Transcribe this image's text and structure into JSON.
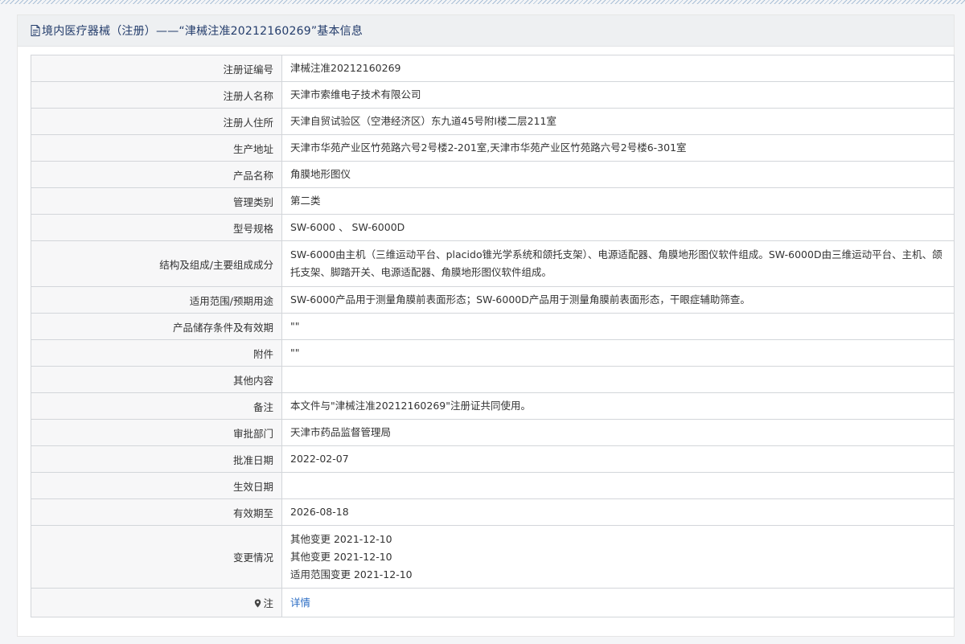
{
  "header": {
    "title": "境内医疗器械（注册）——“津械注准20212160269”基本信息",
    "icon": "document-icon"
  },
  "rows": [
    {
      "label": "注册证编号",
      "value": "津械注准20212160269"
    },
    {
      "label": "注册人名称",
      "value": "天津市索维电子技术有限公司"
    },
    {
      "label": "注册人住所",
      "value": "天津自贸试验区（空港经济区）东九道45号附I楼二层211室"
    },
    {
      "label": "生产地址",
      "value": "天津市华苑产业区竹苑路六号2号楼2-201室,天津市华苑产业区竹苑路六号2号楼6-301室"
    },
    {
      "label": "产品名称",
      "value": "角膜地形图仪"
    },
    {
      "label": "管理类别",
      "value": "第二类"
    },
    {
      "label": "型号规格",
      "value": "SW-6000 、 SW-6000D"
    },
    {
      "label": "结构及组成/主要组成成分",
      "value": "SW-6000由主机（三维运动平台、placido锥光学系统和颌托支架）、电源适配器、角膜地形图仪软件组成。SW-6000D由三维运动平台、主机、颌托支架、脚踏开关、电源适配器、角膜地形图仪软件组成。"
    },
    {
      "label": "适用范围/预期用途",
      "value": "SW-6000产品用于测量角膜前表面形态；SW-6000D产品用于测量角膜前表面形态，干眼症辅助筛查。"
    },
    {
      "label": "产品储存条件及有效期",
      "value": "\"\""
    },
    {
      "label": "附件",
      "value": "\"\""
    },
    {
      "label": "其他内容",
      "value": ""
    },
    {
      "label": "备注",
      "value": "本文件与\"津械注准20212160269\"注册证共同使用。"
    },
    {
      "label": "审批部门",
      "value": "天津市药品监督管理局"
    },
    {
      "label": "批准日期",
      "value": "2022-02-07"
    },
    {
      "label": "生效日期",
      "value": ""
    },
    {
      "label": "有效期至",
      "value": "2026-08-18"
    }
  ],
  "changes": {
    "label": "变更情况",
    "items": [
      "其他变更 2021-12-10",
      "其他变更 2021-12-10",
      "适用范围变更 2021-12-10"
    ]
  },
  "note": {
    "label": "注",
    "icon": "pin-icon",
    "link_text": "详情"
  },
  "colors": {
    "header_text": "#233c6b",
    "link": "#2a6cc4",
    "label_bg": "#f7f7f8",
    "border": "#d3d6da"
  }
}
